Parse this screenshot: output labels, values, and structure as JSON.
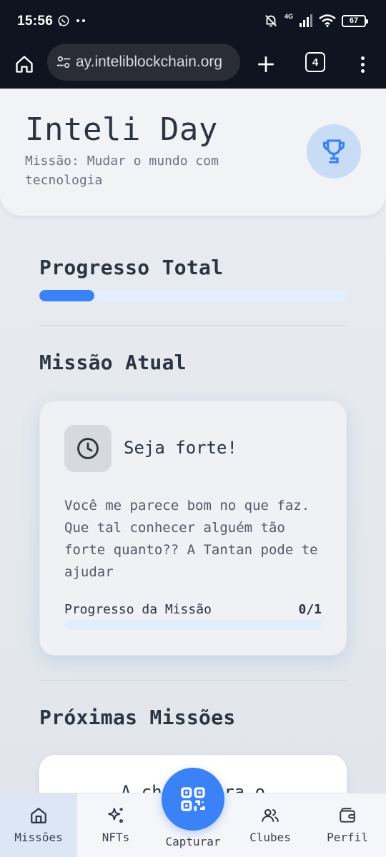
{
  "status_bar": {
    "time": "15:56",
    "network_label": "4G",
    "battery": "67",
    "icons": [
      "whatsapp-icon",
      "more-dots-icon",
      "mute-icon",
      "signal-icon",
      "wifi-icon",
      "battery-icon"
    ]
  },
  "browser": {
    "url": "ay.inteliblockchain.org",
    "tab_count": "4",
    "icons": [
      "home-icon",
      "site-settings-icon",
      "new-tab-icon",
      "tabs-icon",
      "overflow-menu-icon"
    ]
  },
  "header": {
    "title": "Inteli Day",
    "subtitle": "Missão: Mudar o mundo com tecnologia",
    "icon": "trophy-icon"
  },
  "total_progress": {
    "label": "Progresso Total",
    "fraction": 0.18
  },
  "current_mission": {
    "section_label": "Missão Atual",
    "icon": "clock-icon",
    "name": "Seja forte!",
    "description": "Você me parece bom no que faz. Que tal conhecer alguém tão forte quanto?? A Tantan pode te ajudar",
    "progress_label": "Progresso da Missão",
    "progress_value": "0/1",
    "progress_fraction": 0
  },
  "next_missions": {
    "section_label": "Próximas Missões",
    "first_item_text": "A chave para o"
  },
  "bottom_nav": {
    "items": [
      {
        "label": "Missões",
        "icon": "home-icon",
        "active": true
      },
      {
        "label": "NFTs",
        "icon": "sparkles-icon",
        "active": false
      },
      {
        "label": "Capturar",
        "icon": "qr-code-icon",
        "active": false
      },
      {
        "label": "Clubes",
        "icon": "users-icon",
        "active": false
      },
      {
        "label": "Perfil",
        "icon": "wallet-icon",
        "active": false
      }
    ]
  },
  "colors": {
    "accent": "#3b82f6",
    "track": "#e3eefc",
    "trophy_bg": "#c9dcf6"
  }
}
